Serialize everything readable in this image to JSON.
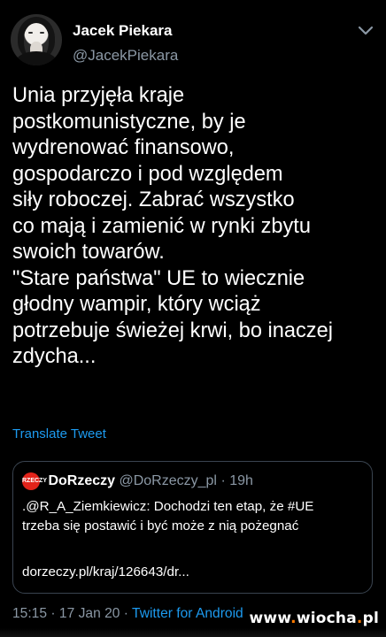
{
  "author": {
    "name": "Jacek Piekara",
    "handle": "@JacekPiekara"
  },
  "tweet": {
    "lines": [
      "Unia przyjęła kraje",
      "postkomunistyczne, by je",
      "wydrenować finansowo,",
      "gospodarczo i pod względem",
      "siły roboczej. Zabrać wszystko",
      "co mają i zamienić w rynki zbytu",
      "swoich towarów.",
      "\"Stare państwa\" UE to wiecznie",
      "głodny wampir, który wciąż",
      "potrzebuje świeżej krwi, bo inaczej",
      "zdycha..."
    ],
    "translate_label": "Translate Tweet"
  },
  "quoted": {
    "logo_text": "RZECZY",
    "name": "DoRzeczy",
    "handle": "@DoRzeczy_pl",
    "separator": "·",
    "time": "19h",
    "body_lines": [
      ".@R_A_Ziemkiewicz: Dochodzi ten etap, że #UE",
      "trzeba się postawić i być może z nią pożegnać"
    ],
    "link": "dorzeczy.pl/kraj/126643/dr..."
  },
  "meta": {
    "time": "15:15",
    "sep1": "·",
    "date": "17 Jan 20",
    "sep2": "·",
    "source": "Twitter for Android"
  },
  "watermark": {
    "prefix": "www",
    "dot1": ".",
    "brand": "wiocha",
    "dot2": ".",
    "tld": "pl"
  },
  "colors": {
    "background": "#000000",
    "link": "#1d9bf0",
    "secondary": "#8b98a5",
    "watermark_dot": "#ff7a00"
  },
  "icons": {
    "menu": "chevron-down-icon",
    "avatar": "hooded-figure-avatar",
    "quoted_logo": "dorzeczy-logo"
  }
}
